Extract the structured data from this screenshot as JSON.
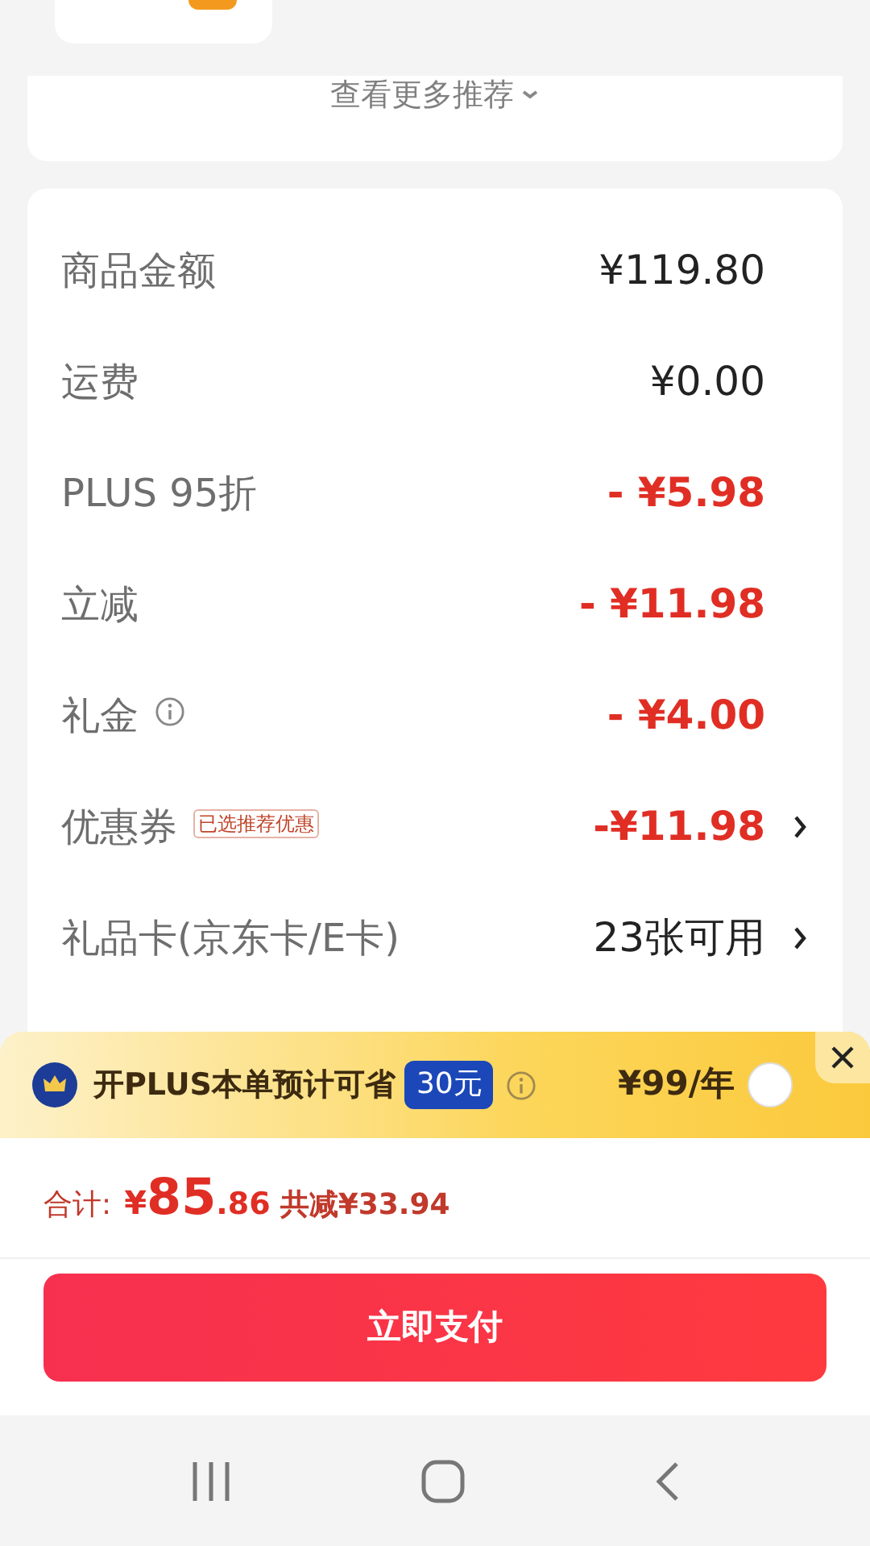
{
  "recommend": {
    "more_label": "查看更多推荐"
  },
  "fees": [
    {
      "label": "商品金额",
      "kind": "normal",
      "value": "¥119.80",
      "info": false,
      "arrow": false
    },
    {
      "label": "运费",
      "kind": "normal",
      "value": "¥0.00",
      "info": false,
      "arrow": false
    },
    {
      "label": "PLUS 95折",
      "kind": "discount",
      "value": "- ¥5.98",
      "info": false,
      "arrow": false
    },
    {
      "label": "立减",
      "kind": "discount",
      "value": "- ¥11.98",
      "info": false,
      "arrow": false
    },
    {
      "label": "礼金",
      "kind": "discount",
      "value": "- ¥4.00",
      "info": true,
      "arrow": false
    },
    {
      "label": "优惠券",
      "kind": "discount",
      "value": "-¥11.98",
      "info": false,
      "arrow": true,
      "badge": "已选推荐优惠"
    },
    {
      "label": "礼品卡(京东卡/E卡)",
      "kind": "normal",
      "value": "23张可用",
      "info": false,
      "arrow": true
    }
  ],
  "plus_bar": {
    "text": "开PLUS本单预计可省",
    "saving": "30元",
    "price": "¥99/年",
    "selected": false
  },
  "total": {
    "label": "合计:",
    "currency": "¥",
    "integer": "85",
    "decimal": ".86",
    "reduction": "共减¥33.94"
  },
  "pay_button": "立即支付"
}
